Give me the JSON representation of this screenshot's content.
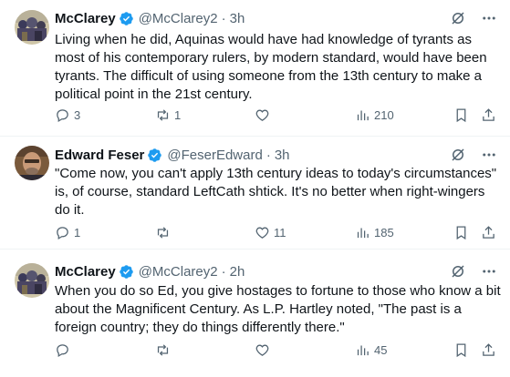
{
  "tweets": [
    {
      "name": "McClarey",
      "handle": "@McClarey2",
      "time": "3h",
      "text": "Living when he did, Aquinas would have had knowledge of tyrants as most of his contemporary rulers, by modern standard, would have been tyrants. The difficult of using someone from the 13th century to make a political point in the 21st century.",
      "replies": "3",
      "reposts": "1",
      "likes": "",
      "views": "210"
    },
    {
      "name": "Edward Feser",
      "handle": "@FeserEdward",
      "time": "3h",
      "text": "\"Come now, you can't apply 13th century ideas to today's circumstances\" is, of course, standard LeftCath shtick. It's no better when right-wingers do it.",
      "replies": "1",
      "reposts": "",
      "likes": "11",
      "views": "185"
    },
    {
      "name": "McClarey",
      "handle": "@McClarey2",
      "time": "2h",
      "text": "When you do so Ed, you give hostages to fortune to those who know a bit about the Magnificent Century.  As L.P. Hartley noted, \"The past is a foreign country;  they do things differently there.\"",
      "replies": "",
      "reposts": "",
      "likes": "",
      "views": "45"
    }
  ],
  "separator": "·",
  "colors": {
    "text": "#0f1419",
    "muted": "#536471",
    "verified": "#1d9bf0",
    "divider": "#eff3f4"
  },
  "icons": [
    "verified-badge-icon",
    "grok-icon",
    "more-icon",
    "reply-icon",
    "repost-icon",
    "like-icon",
    "views-icon",
    "bookmark-icon",
    "share-icon"
  ]
}
